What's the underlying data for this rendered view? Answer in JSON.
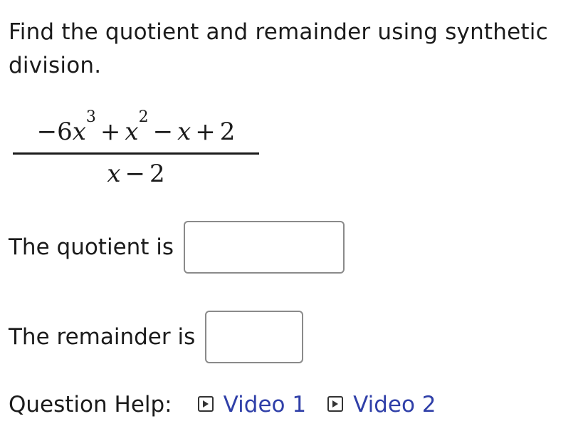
{
  "prompt": "Find the quotient and remainder using synthetic division.",
  "fraction": {
    "numerator": {
      "t1_sign": "−",
      "t1_coef": "6",
      "t1_var": "x",
      "t1_exp": "3",
      "op1": "+",
      "t2_var": "x",
      "t2_exp": "2",
      "op2": "−",
      "t3_var": "x",
      "op3": "+",
      "t4": "2"
    },
    "denominator": {
      "var": "x",
      "op": "−",
      "const": "2"
    }
  },
  "quotient": {
    "label": "The quotient is",
    "value": ""
  },
  "remainder": {
    "label": "The remainder is",
    "value": ""
  },
  "help": {
    "label": "Question Help:",
    "videos": [
      {
        "label": "Video 1",
        "icon": "play-icon"
      },
      {
        "label": "Video 2",
        "icon": "play-icon"
      }
    ]
  },
  "colors": {
    "text": "#1b1b1b",
    "link": "#2f3fa8",
    "input_border": "#8a8a8a"
  }
}
